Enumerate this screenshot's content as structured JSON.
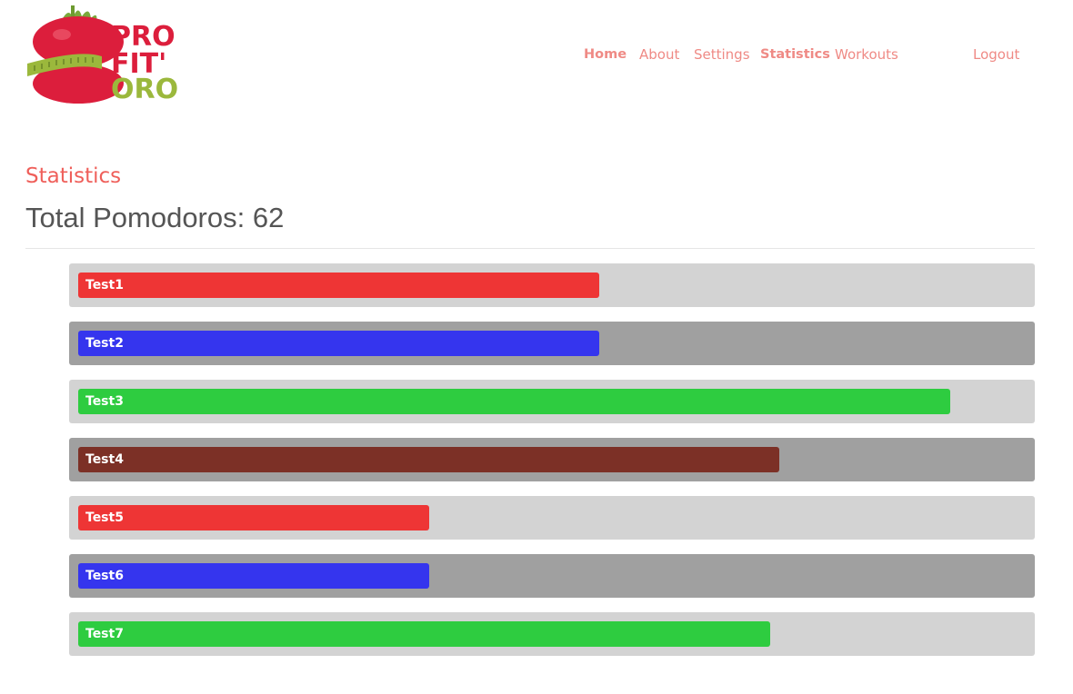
{
  "header": {
    "logo": {
      "lines": [
        "PRO",
        "FIT'",
        "ORO"
      ],
      "icon": "tomato-tape-measure-logo"
    },
    "nav": [
      {
        "label": "Home",
        "bold": true
      },
      {
        "label": "About",
        "bold": false
      },
      {
        "label": "Settings",
        "bold": false
      },
      {
        "label": "Statistics",
        "bold": true
      },
      {
        "label": "Workouts",
        "bold": false
      },
      {
        "label": "Logout",
        "bold": false
      }
    ]
  },
  "main": {
    "section_title": "Statistics",
    "total": "Total Pomodoros: 62"
  },
  "colors": {
    "nav": "#ef8a85",
    "title": "#ef5f5a",
    "track_light": "#d3d3d3",
    "track_dark": "#a0a0a0"
  },
  "chart_data": {
    "type": "bar",
    "categories": [
      "Test1",
      "Test2",
      "Test3",
      "Test4",
      "Test5",
      "Test6",
      "Test7"
    ],
    "values": [
      0.55,
      0.55,
      0.92,
      0.74,
      0.37,
      0.37,
      0.73
    ],
    "colors": [
      "#ee3535",
      "#3535ee",
      "#2ecc40",
      "#7c3026",
      "#ee3535",
      "#3535ee",
      "#2ecc40"
    ],
    "track_colors": [
      "#d3d3d3",
      "#a0a0a0",
      "#d3d3d3",
      "#a0a0a0",
      "#d3d3d3",
      "#a0a0a0",
      "#d3d3d3"
    ]
  }
}
